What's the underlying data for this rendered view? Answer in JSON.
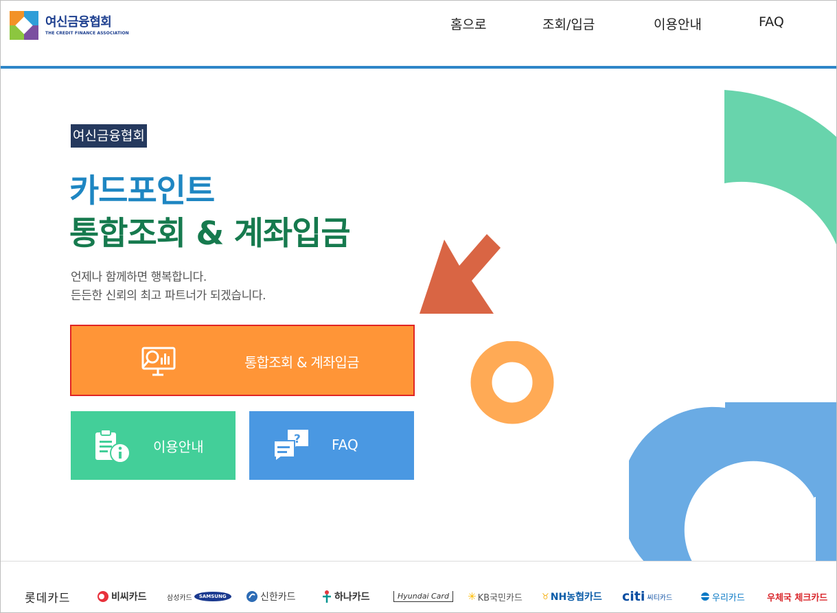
{
  "header": {
    "logo_title": "여신금융협회",
    "logo_sub": "THE CREDIT FINANCE ASSOCIATION",
    "nav": [
      "홈으로",
      "조회/입금",
      "이용안내",
      "FAQ"
    ]
  },
  "hero": {
    "badge": "여신금융협회",
    "title_line1": "카드포인트",
    "title_line2": "통합조회 & 계좌입금",
    "desc_line1": "언제나 함께하면 행복합니다.",
    "desc_line2": "든든한 신뢰의 최고 파트너가 되겠습니다."
  },
  "buttons": {
    "main": "통합조회 & 계좌입금",
    "guide": "이용안내",
    "faq": "FAQ"
  },
  "partners": [
    "롯데카드",
    "비씨카드",
    "삼성카드",
    "SAMSUNG",
    "신한카드",
    "하나카드",
    "Hyundai Card",
    "KB국민카드",
    "NH농협카드",
    "citi",
    "씨티카드",
    "우리카드",
    "우체국 체크카드"
  ],
  "colors": {
    "primary_blue": "#1e86c2",
    "primary_green": "#167a4e",
    "badge_bg": "#25395e",
    "main_button": "#ff9537",
    "guide_button": "#43cf99",
    "faq_button": "#4a98e2",
    "arrow": "#d96544"
  }
}
